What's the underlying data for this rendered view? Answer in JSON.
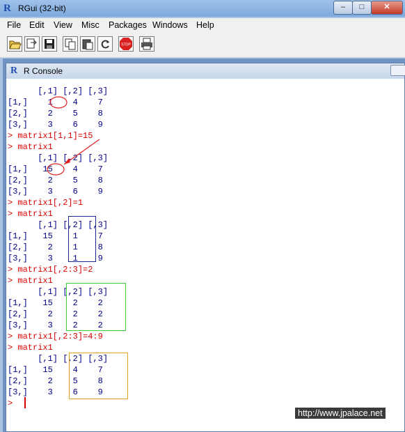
{
  "window": {
    "title": "RGui (32-bit)",
    "min": "–",
    "max": "□",
    "close": "✕"
  },
  "menu": [
    "File",
    "Edit",
    "View",
    "Misc",
    "Packages",
    "Windows",
    "Help"
  ],
  "toolbar": [
    {
      "icon": "open-script-icon"
    },
    {
      "icon": "load-workspace-icon"
    },
    {
      "icon": "save-workspace-icon"
    },
    {
      "icon": "copy-icon"
    },
    {
      "icon": "paste-icon"
    },
    {
      "icon": "copy-paste-icon"
    },
    {
      "icon": "stop-icon",
      "label": "STOP"
    },
    {
      "icon": "print-icon"
    }
  ],
  "console": {
    "title": "R Console",
    "lines": [
      {
        "t": "      [,1] [,2] [,3]",
        "k": "out"
      },
      {
        "t": "[1,]    1    4    7",
        "k": "out"
      },
      {
        "t": "[2,]    2    5    8",
        "k": "out"
      },
      {
        "t": "[3,]    3    6    9",
        "k": "out"
      },
      {
        "t": "> matrix1[1,1]=15",
        "k": "in"
      },
      {
        "t": "> matrix1",
        "k": "in"
      },
      {
        "t": "      [,1] [,2] [,3]",
        "k": "out"
      },
      {
        "t": "[1,]   15    4    7",
        "k": "out"
      },
      {
        "t": "[2,]    2    5    8",
        "k": "out"
      },
      {
        "t": "[3,]    3    6    9",
        "k": "out"
      },
      {
        "t": "> matrix1[,2]=1",
        "k": "in"
      },
      {
        "t": "> matrix1",
        "k": "in"
      },
      {
        "t": "      [,1] [,2] [,3]",
        "k": "out"
      },
      {
        "t": "[1,]   15    1    7",
        "k": "out"
      },
      {
        "t": "[2,]    2    1    8",
        "k": "out"
      },
      {
        "t": "[3,]    3    1    9",
        "k": "out"
      },
      {
        "t": "> matrix1[,2:3]=2",
        "k": "in"
      },
      {
        "t": "> matrix1",
        "k": "in"
      },
      {
        "t": "      [,1] [,2] [,3]",
        "k": "out"
      },
      {
        "t": "[1,]   15    2    2",
        "k": "out"
      },
      {
        "t": "[2,]    2    2    2",
        "k": "out"
      },
      {
        "t": "[3,]    3    2    2",
        "k": "out"
      },
      {
        "t": "> matrix1[,2:3]=4:9",
        "k": "in"
      },
      {
        "t": "> matrix1",
        "k": "in"
      },
      {
        "t": "      [,1] [,2] [,3]",
        "k": "out"
      },
      {
        "t": "[1,]   15    4    7",
        "k": "out"
      },
      {
        "t": "[2,]    2    5    8",
        "k": "out"
      },
      {
        "t": "[3,]    3    6    9",
        "k": "out"
      },
      {
        "t": ">",
        "k": "in"
      }
    ]
  },
  "colors": {
    "annotation_red": "#e02020",
    "box_blue": "#1a2a8a",
    "box_green": "#3ccc3c",
    "box_orange": "#e6a020"
  },
  "watermark": "http://www.jpalace.net"
}
